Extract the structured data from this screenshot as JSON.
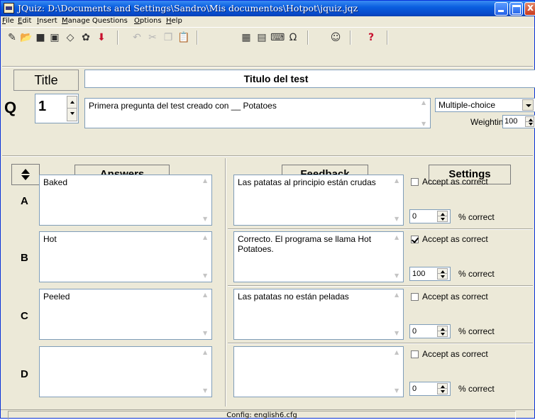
{
  "window": {
    "title": "JQuiz: D:\\Documents and Settings\\Sandro\\Mis documentos\\Hotpot\\jquiz.jqz"
  },
  "menu": [
    "File",
    "Edit",
    "Insert",
    "Manage Questions",
    "Options",
    "Help"
  ],
  "toolbar": {
    "icons": [
      "new-file-icon",
      "open-folder-icon",
      "save-icon",
      "save-as-icon",
      "clear-icon",
      "compile-web-icon",
      "arrow-down-icon",
      "undo-icon",
      "cut-icon",
      "copy-icon",
      "paste-icon",
      "export-web-icon",
      "export-print-icon",
      "keyboard-icon",
      "chars-icon",
      "tutorial-icon",
      "help-icon"
    ],
    "glyphs": [
      "✎",
      "📂",
      "■",
      "▣",
      "◇",
      "✿",
      "⬇",
      "↶",
      "✂",
      "❐",
      "📋",
      "▦",
      "▤",
      "⌨",
      "Ω",
      "☺",
      "?"
    ]
  },
  "title_label": "Title",
  "title_value": "Titulo del test",
  "question": {
    "label": "Q",
    "number": "1",
    "text": "Primera pregunta del test creado con __ Potatoes",
    "type": "Multiple-choice",
    "weighting_label": "Weighting:",
    "weighting_value": "100"
  },
  "headers": {
    "answers": "Answers",
    "feedback": "Feedback",
    "settings": "Settings"
  },
  "accept_label": "Accept as correct",
  "pct_label": "% correct",
  "answers": [
    {
      "letter": "A",
      "answer": "Baked",
      "feedback": "Las patatas al principio están crudas",
      "correct": false,
      "percent": "0"
    },
    {
      "letter": "B",
      "answer": "Hot",
      "feedback": "Correcto. El programa se llama Hot Potatoes.",
      "correct": true,
      "percent": "100"
    },
    {
      "letter": "C",
      "answer": "Peeled",
      "feedback": "Las patatas no están peladas",
      "correct": false,
      "percent": "0"
    },
    {
      "letter": "D",
      "answer": "",
      "feedback": "",
      "correct": false,
      "percent": "0"
    }
  ],
  "status": {
    "config": "Config: english6.cfg"
  }
}
